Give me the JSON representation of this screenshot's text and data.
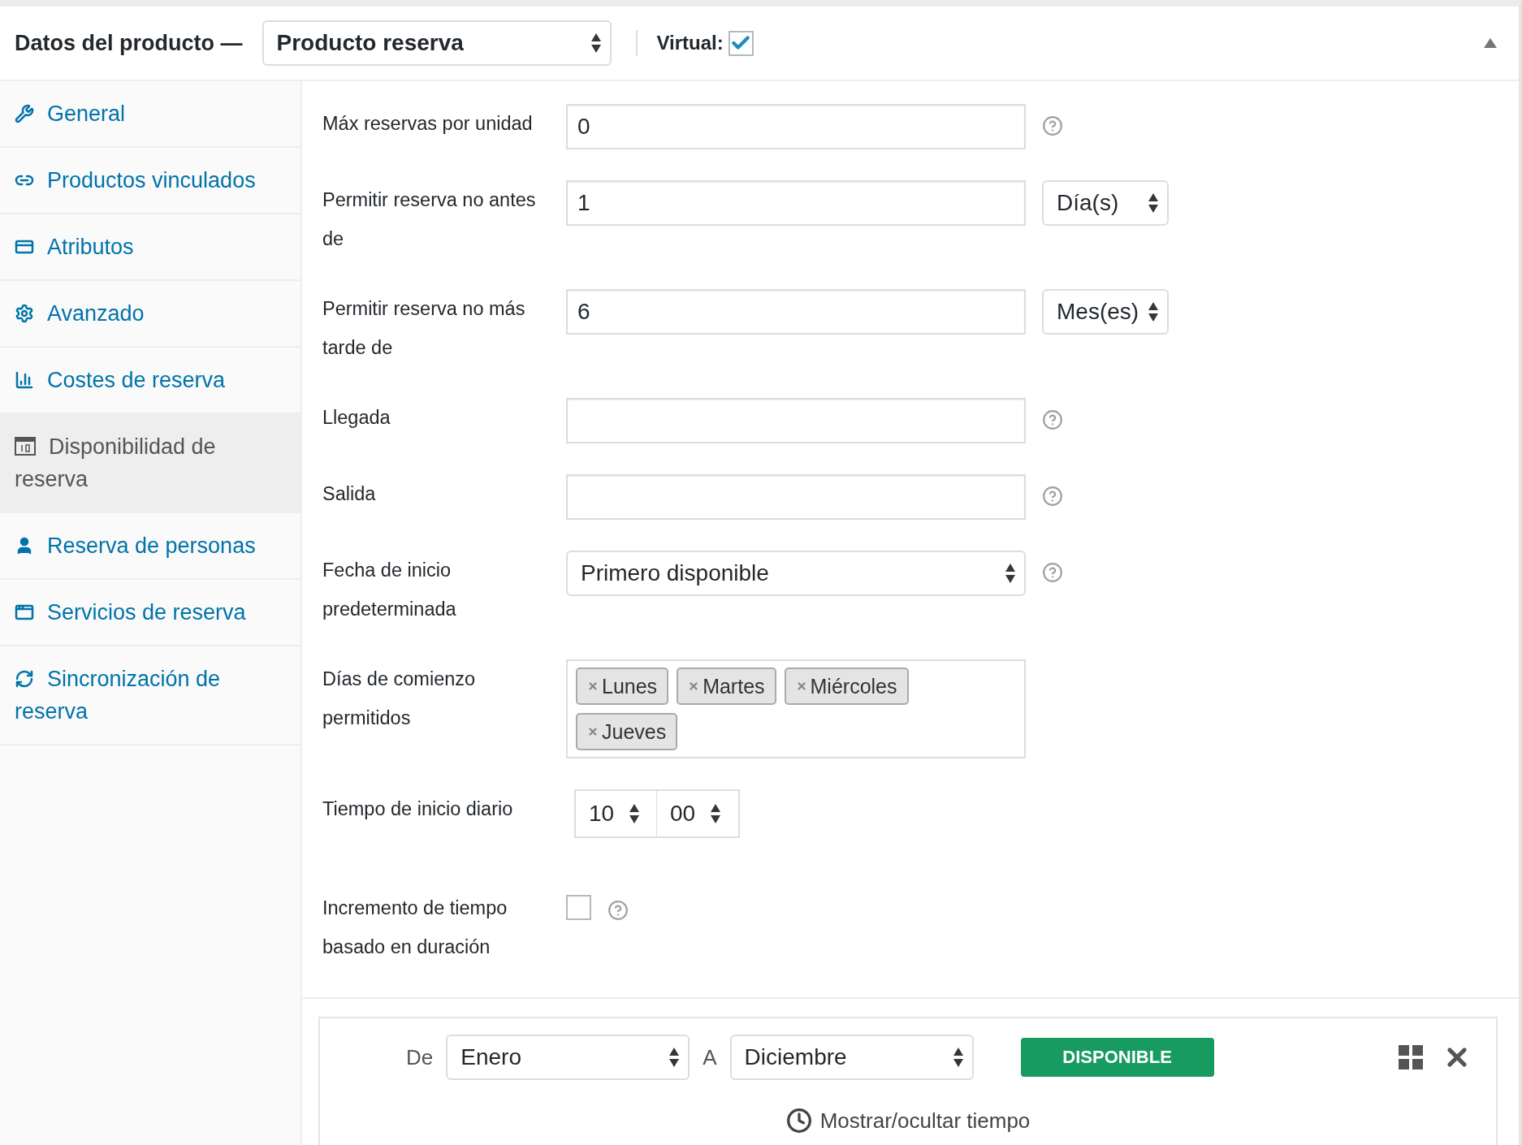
{
  "header": {
    "title": "Datos del producto —",
    "product_type": "Producto reserva",
    "virtual_label": "Virtual:",
    "virtual_checked": true
  },
  "sidebar": {
    "items": [
      {
        "label": "General",
        "selected": false
      },
      {
        "label": "Productos vinculados",
        "selected": false
      },
      {
        "label": "Atributos",
        "selected": false
      },
      {
        "label": "Avanzado",
        "selected": false
      },
      {
        "label": "Costes de reserva",
        "selected": false
      },
      {
        "label": "Disponibilidad de reserva",
        "selected": true
      },
      {
        "label": "Reserva de personas",
        "selected": false
      },
      {
        "label": "Servicios de reserva",
        "selected": false
      },
      {
        "label": "Sincronización de reserva",
        "selected": false
      }
    ]
  },
  "fields": [
    {
      "kind": "text",
      "label": "Máx reservas por unidad",
      "value": "0",
      "help": true
    },
    {
      "kind": "text_unit",
      "label": "Permitir reserva no antes de",
      "value": "1",
      "unit": "Día(s)",
      "help": false
    },
    {
      "kind": "text_unit",
      "label": "Permitir reserva no más tarde de",
      "value": "6",
      "unit": "Mes(es)",
      "help": false
    },
    {
      "kind": "text",
      "label": "Llegada",
      "help": true
    },
    {
      "kind": "text",
      "label": "Salida",
      "help": true
    },
    {
      "kind": "select",
      "label": "Fecha de inicio predeterminada",
      "value": "Primero disponible",
      "help": true
    },
    {
      "kind": "tags",
      "label": "Días de comienzo permitidos",
      "tags": [
        "Lunes",
        "Martes",
        "Miércoles",
        "Jueves"
      ],
      "help": false
    },
    {
      "kind": "time",
      "label": "Tiempo de inicio diario",
      "hour": "10",
      "minute": "00",
      "help": false
    },
    {
      "kind": "checkbox",
      "label": "Incremento de tiempo basado en duración",
      "checked": false,
      "help": true
    }
  ],
  "rule": {
    "from_label": "De",
    "from": "Enero",
    "to_label": "A",
    "to": "Diciembre",
    "status": "DISPONIBLE",
    "toggle": "Mostrar/ocultar tiempo"
  }
}
